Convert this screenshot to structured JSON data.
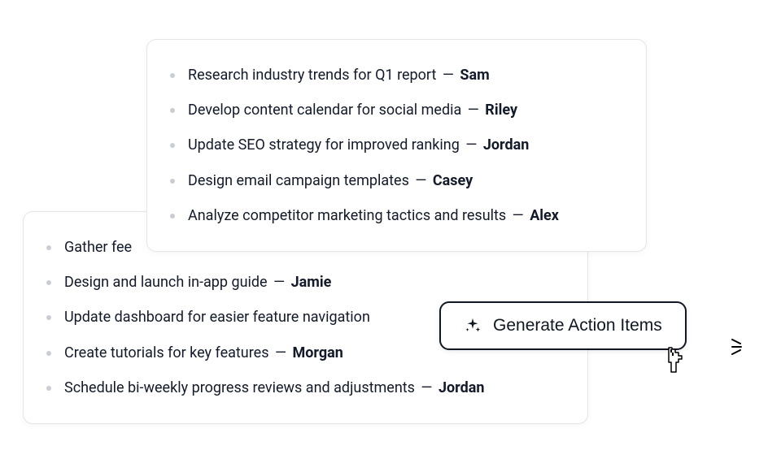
{
  "back_card": {
    "items": [
      {
        "task": "Gather fee",
        "assignee": ""
      },
      {
        "task": "Design and launch in-app guide",
        "assignee": "Jamie"
      },
      {
        "task": "Update dashboard for easier feature navigation",
        "assignee": ""
      },
      {
        "task": "Create tutorials for key features",
        "assignee": "Morgan"
      },
      {
        "task": "Schedule bi-weekly progress reviews and adjustments",
        "assignee": "Jordan"
      }
    ]
  },
  "front_card": {
    "items": [
      {
        "task": "Research industry trends for Q1 report",
        "assignee": "Sam"
      },
      {
        "task": "Develop content calendar for social media",
        "assignee": "Riley"
      },
      {
        "task": "Update SEO strategy for improved ranking",
        "assignee": "Jordan"
      },
      {
        "task": "Design email campaign templates",
        "assignee": "Casey"
      },
      {
        "task": "Analyze competitor marketing tactics and results",
        "assignee": "Alex"
      }
    ]
  },
  "button": {
    "label": "Generate Action Items"
  },
  "separator": "—"
}
